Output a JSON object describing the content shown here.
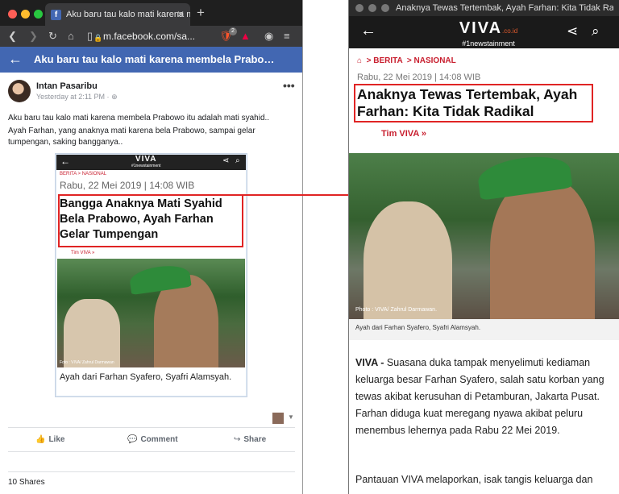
{
  "left_window": {
    "tab_title": "Aku baru tau kalo mati karena m",
    "tab_favicon": "f",
    "url": "m.facebook.com/sa...",
    "shield_badge": "2",
    "header_title": "Aku baru tau kalo mati karena membela Prabowo itu ...",
    "post": {
      "author": "Intan Pasaribu",
      "timestamp": "Yesterday at 2:11 PM · ",
      "text_1": "Aku baru tau kalo mati karena membela Prabowo itu adalah mati syahid..",
      "text_2": "Ayah Farhan, yang anaknya mati karena bela Prabowo, sampai gelar tumpengan, saking bangganya..",
      "embed": {
        "logo": "VIVA",
        "logo_sub": "#1newstainment",
        "breadcrumb": "BERITA  >  NASIONAL",
        "date": "Rabu, 22 Mei 2019 | 14:08 WIB",
        "headline": "Bangga Anaknya Mati Syahid Bela Prabowo, Ayah Farhan Gelar Tumpengan",
        "author": "Tim VIVA »",
        "photo_credit": "Foto :  VIVA/ Zahrul Darmawan",
        "caption": "Ayah dari Farhan Syafero, Syafri Alamsyah."
      },
      "actions": {
        "like": "Like",
        "comment": "Comment",
        "share": "Share"
      },
      "shares": "10 Shares"
    }
  },
  "right_window": {
    "window_title": "Anaknya Tewas Tertembak, Ayah Farhan: Kita Tidak Ra...",
    "logo": "VIVA",
    "logo_domain": ".co.id",
    "logo_sub": "#1newstainment",
    "breadcrumb_berita": "BERITA",
    "breadcrumb_nasional": "NASIONAL",
    "date": "Rabu, 22 Mei 2019 | 14:08 WIB",
    "headline": "Anaknya Tewas Tertembak, Ayah Farhan: Kita Tidak Radikal",
    "author": "Tim VIVA »",
    "photo_credit": "Photo :  VIVA/ Zahrul Darmawan.",
    "caption": "Ayah dari Farhan Syafero, Syafri Alamsyah.",
    "body_lead": "VIVA - ",
    "body_1": "Suasana duka tampak menyelimuti kediaman keluarga besar Farhan Syafero, salah satu korban yang tewas akibat kerusuhan di Petamburan, Jakarta Pusat. Farhan diduga kuat meregang nyawa akibat peluru menembus lehernya pada Rabu 22 Mei 2019.",
    "body_2": "Pantauan VIVA melaporkan, isak tangis keluarga dan"
  },
  "colors": {
    "facebook_blue": "#4267b2",
    "highlight_red": "#e02424",
    "viva_red": "#c81e2e"
  }
}
